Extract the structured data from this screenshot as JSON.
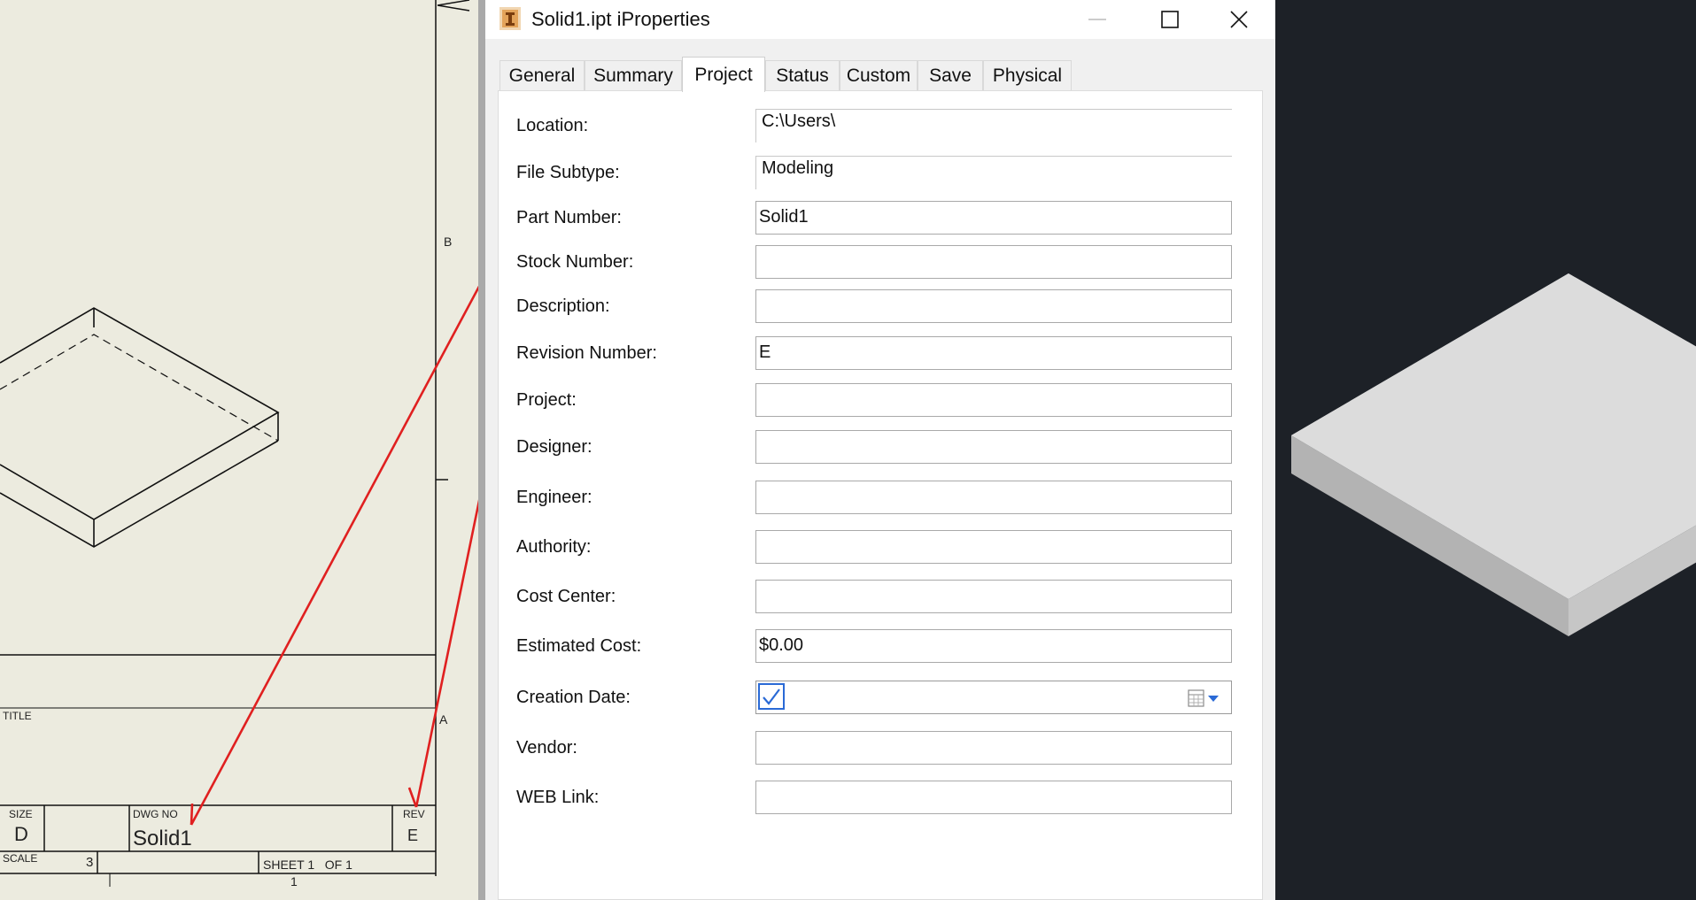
{
  "drawing": {
    "zone_b": "B",
    "zone_a": "A",
    "title_block": {
      "title_label": "TITLE",
      "size_label": "SIZE",
      "size_value": "D",
      "dwg_no_label": "DWG NO",
      "dwg_no_value": "Solid1",
      "rev_label": "REV",
      "rev_value": "E",
      "scale_label": "SCALE",
      "scale_value": "3",
      "sheet_text": "SHEET 1   OF 1",
      "bottom_number": "1"
    }
  },
  "dialog": {
    "title": "Solid1.ipt iProperties",
    "tabs": [
      {
        "label": "General"
      },
      {
        "label": "Summary"
      },
      {
        "label": "Project"
      },
      {
        "label": "Status"
      },
      {
        "label": "Custom"
      },
      {
        "label": "Save"
      },
      {
        "label": "Physical"
      }
    ],
    "active_tab": "Project",
    "fields": {
      "location": {
        "label": "Location:",
        "value": "C:\\Users\\"
      },
      "file_subtype": {
        "label": "File Subtype:",
        "value": "Modeling"
      },
      "part_number": {
        "label": "Part Number:",
        "value": "Solid1"
      },
      "stock_number": {
        "label": "Stock Number:",
        "value": ""
      },
      "description": {
        "label": "Description:",
        "value": ""
      },
      "revision_number": {
        "label": "Revision Number:",
        "value": "E"
      },
      "project": {
        "label": "Project:",
        "value": ""
      },
      "designer": {
        "label": "Designer:",
        "value": ""
      },
      "engineer": {
        "label": "Engineer:",
        "value": ""
      },
      "authority": {
        "label": "Authority:",
        "value": ""
      },
      "cost_center": {
        "label": "Cost Center:",
        "value": ""
      },
      "estimated_cost": {
        "label": "Estimated Cost:",
        "value": "$0.00"
      },
      "creation_date": {
        "label": "Creation Date:",
        "value": "",
        "checked": true
      },
      "vendor": {
        "label": "Vendor:",
        "value": ""
      },
      "web_link": {
        "label": "WEB Link:",
        "value": ""
      }
    }
  },
  "colors": {
    "annotation_arrow": "#e02020",
    "accent": "#2a6ad6",
    "viewport_bg": "#1d2127"
  }
}
